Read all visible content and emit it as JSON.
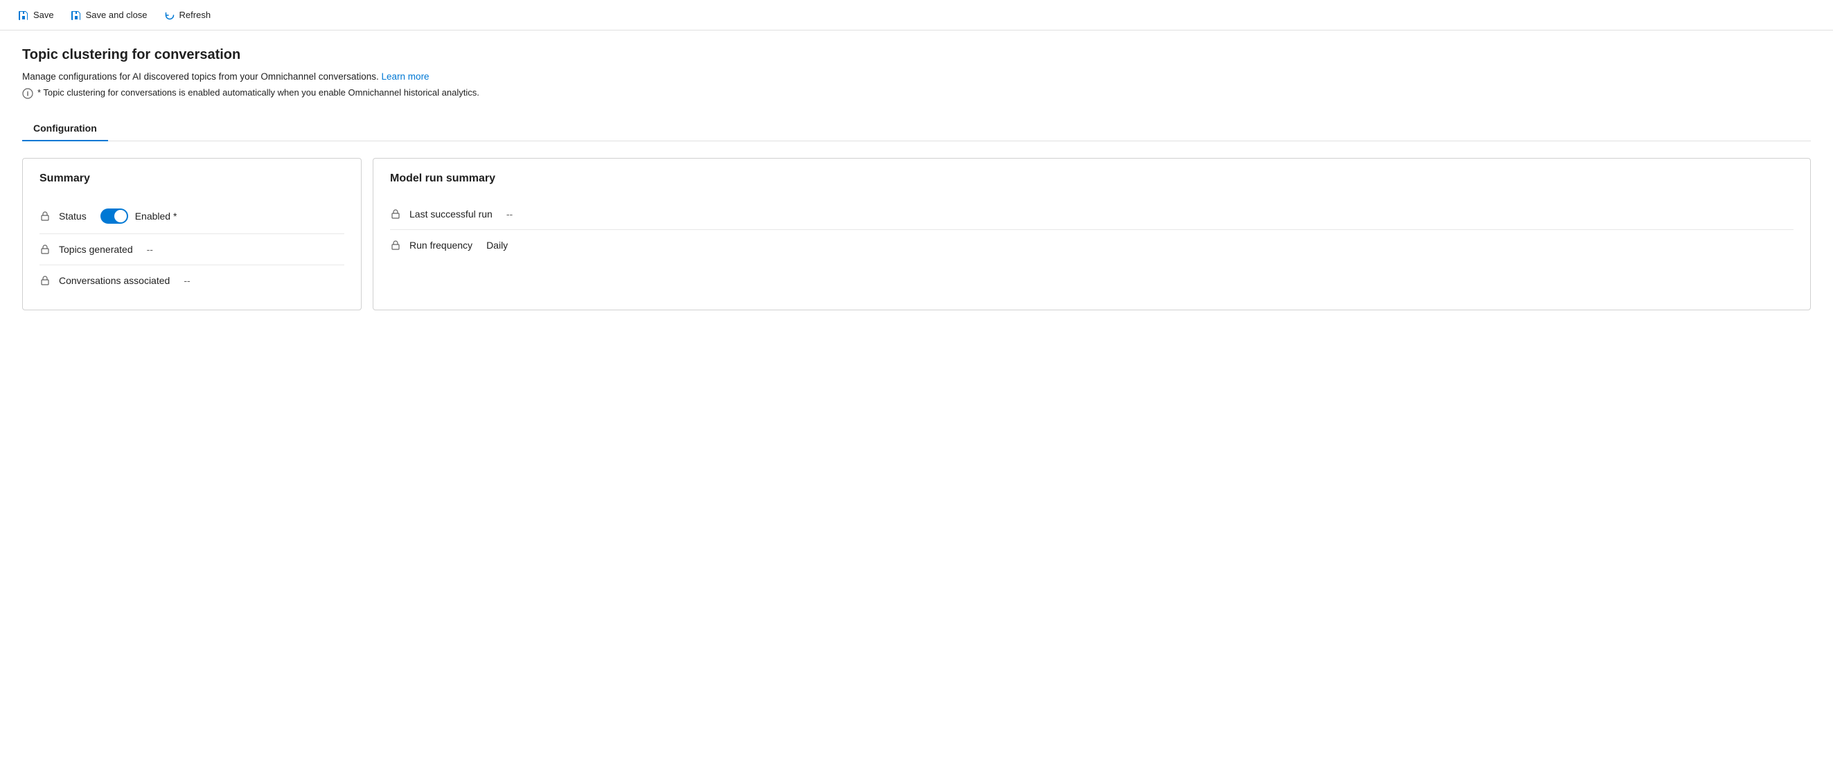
{
  "toolbar": {
    "save_label": "Save",
    "save_close_label": "Save and close",
    "refresh_label": "Refresh"
  },
  "page": {
    "title": "Topic clustering for conversation",
    "description": "Manage configurations for AI discovered topics from your Omnichannel conversations.",
    "learn_more_label": "Learn more",
    "info_note": "* Topic clustering for conversations is enabled automatically when you enable Omnichannel historical analytics."
  },
  "tabs": [
    {
      "label": "Configuration",
      "active": true
    }
  ],
  "summary_card": {
    "title": "Summary",
    "fields": [
      {
        "label": "Status",
        "type": "toggle",
        "toggle_state": "enabled",
        "value": "Enabled *"
      },
      {
        "label": "Topics generated",
        "value": "--"
      },
      {
        "label": "Conversations associated",
        "value": "--"
      }
    ]
  },
  "model_run_card": {
    "title": "Model run summary",
    "fields": [
      {
        "label": "Last successful run",
        "value": "--"
      },
      {
        "label": "Run frequency",
        "value": "Daily"
      }
    ]
  }
}
